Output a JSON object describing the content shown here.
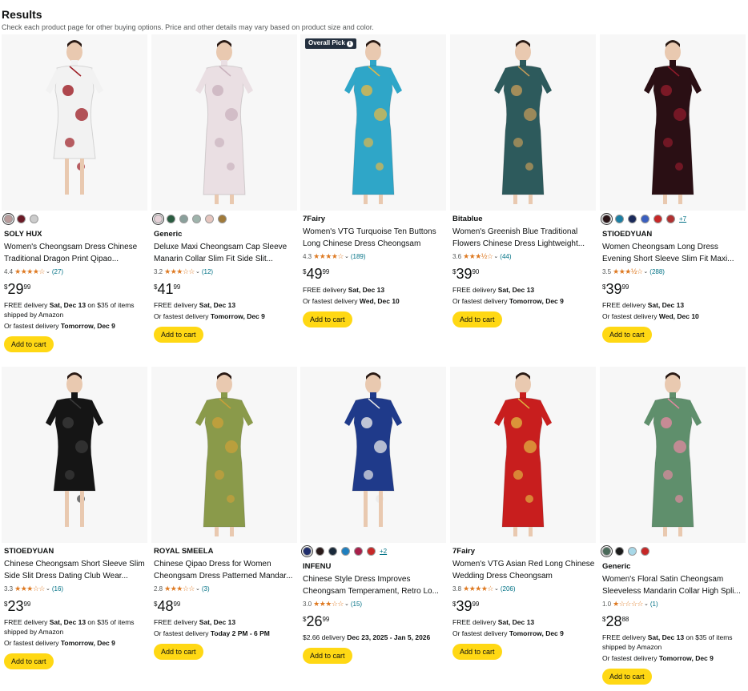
{
  "header": {
    "title": "Results",
    "subtitle": "Check each product page for other buying options. Price and other details may vary based on product size and color."
  },
  "products": [
    {
      "brand": "SOLY HUX",
      "title": "Women's Cheongsam Dress Chinese Traditional Dragon Print Qipao...",
      "rating": "4.4",
      "stars": "★★★★☆",
      "count": "(27)",
      "price_symbol": "$",
      "price_whole": "29",
      "price_cents": "99",
      "delivery_1_pre": "FREE delivery ",
      "delivery_1_bold": "Sat, Dec 13",
      "delivery_1_post": " on $35 of items shipped by Amazon",
      "delivery_2_pre": "Or fastest delivery ",
      "delivery_2_bold": "Tomorrow, Dec 9",
      "cart_label": "Add to cart",
      "badge": "",
      "swatches": [
        "#b99b9b",
        "#6b1a26",
        "#cccccc"
      ],
      "more": "",
      "dress_color": "#f2f2f2",
      "accent_color": "#9c1c23"
    },
    {
      "brand": "Generic",
      "title": "Deluxe Maxi Cheongsam Cap Sleeve Manarin Collar Slim Fit Side Slit...",
      "rating": "3.2",
      "stars": "★★★☆☆",
      "count": "(12)",
      "price_symbol": "$",
      "price_whole": "41",
      "price_cents": "99",
      "delivery_1_pre": "FREE delivery ",
      "delivery_1_bold": "Sat, Dec 13",
      "delivery_1_post": "",
      "delivery_2_pre": "Or fastest delivery ",
      "delivery_2_bold": "Tomorrow, Dec 9",
      "cart_label": "Add to cart",
      "badge": "",
      "swatches": [
        "#e6d2d8",
        "#2a5c40",
        "#8aa09b",
        "#9fb4ac",
        "#e6c6bf",
        "#a07a3a"
      ],
      "more": "",
      "dress_color": "#eadfe3",
      "accent_color": "#c9b2bd"
    },
    {
      "brand": "7Fairy",
      "title": "Women's VTG Turquoise Ten Buttons Long Chinese Dress Cheongsam",
      "rating": "4.3",
      "stars": "★★★★☆",
      "count": "(189)",
      "price_symbol": "$",
      "price_whole": "49",
      "price_cents": "99",
      "delivery_1_pre": "FREE delivery ",
      "delivery_1_bold": "Sat, Dec 13",
      "delivery_1_post": "",
      "delivery_2_pre": "Or fastest delivery ",
      "delivery_2_bold": "Wed, Dec 10",
      "cart_label": "Add to cart",
      "badge": "Overall Pick",
      "swatches": [],
      "more": "",
      "dress_color": "#2fa6c8",
      "accent_color": "#e0b84a"
    },
    {
      "brand": "Bitablue",
      "title": "Women's Greenish Blue Traditional Flowers Chinese Dress Lightweight...",
      "rating": "3.6",
      "stars": "★★★½☆",
      "count": "(44)",
      "price_symbol": "$",
      "price_whole": "39",
      "price_cents": "90",
      "delivery_1_pre": "FREE delivery ",
      "delivery_1_bold": "Sat, Dec 13",
      "delivery_1_post": "",
      "delivery_2_pre": "Or fastest delivery ",
      "delivery_2_bold": "Tomorrow, Dec 9",
      "cart_label": "Add to cart",
      "badge": "",
      "swatches": [],
      "more": "",
      "dress_color": "#2d5a5c",
      "accent_color": "#c09a5a"
    },
    {
      "brand": "STIOEDYUAN",
      "title": "Women Cheongsam Long Dress Evening Short Sleeve Slim Fit Maxi...",
      "rating": "3.5",
      "stars": "★★★½☆",
      "count": "(288)",
      "price_symbol": "$",
      "price_whole": "39",
      "price_cents": "99",
      "delivery_1_pre": "FREE delivery ",
      "delivery_1_bold": "Sat, Dec 13",
      "delivery_1_post": "",
      "delivery_2_pre": "Or fastest delivery ",
      "delivery_2_bold": "Wed, Dec 10",
      "cart_label": "Add to cart",
      "badge": "",
      "swatches": [
        "#2a1518",
        "#1c7fa3",
        "#1a2a5a",
        "#3b5fbf",
        "#c62828",
        "#b03030"
      ],
      "more": "+7",
      "dress_color": "#2a0f14",
      "accent_color": "#8e1b2b"
    },
    {
      "brand": "STIOEDYUAN",
      "title": "Chinese Cheongsam Short Sleeve Slim Side Slit Dress Dating Club Wear...",
      "rating": "3.3",
      "stars": "★★★☆☆",
      "count": "(16)",
      "price_symbol": "$",
      "price_whole": "23",
      "price_cents": "99",
      "delivery_1_pre": "FREE delivery ",
      "delivery_1_bold": "Sat, Dec 13",
      "delivery_1_post": " on $35 of items shipped by Amazon",
      "delivery_2_pre": "Or fastest delivery ",
      "delivery_2_bold": "Tomorrow, Dec 9",
      "cart_label": "Add to cart",
      "badge": "",
      "swatches": [],
      "more": "",
      "dress_color": "#151515",
      "accent_color": "#3a3a3a"
    },
    {
      "brand": "ROYAL SMEELA",
      "title": "Chinese Qipao Dress for Women Cheongsam Dress Patterned Mandar...",
      "rating": "2.8",
      "stars": "★★★☆☆",
      "count": "(3)",
      "price_symbol": "$",
      "price_whole": "48",
      "price_cents": "99",
      "delivery_1_pre": "FREE delivery ",
      "delivery_1_bold": "Sat, Dec 13",
      "delivery_1_post": "",
      "delivery_2_pre": "Or fastest delivery ",
      "delivery_2_bold": "Today 2 PM - 6 PM",
      "cart_label": "Add to cart",
      "badge": "",
      "swatches": [],
      "more": "",
      "dress_color": "#8a9a4a",
      "accent_color": "#c9a03a"
    },
    {
      "brand": "INFENU",
      "title": "Chinese Style Dress Improves Cheongsam Temperament, Retro Lo...",
      "rating": "3.0",
      "stars": "★★★☆☆",
      "count": "(15)",
      "price_symbol": "$",
      "price_whole": "26",
      "price_cents": "99",
      "delivery_1_pre": "$2.66 delivery ",
      "delivery_1_bold": "Dec 23, 2025 - Jan 5, 2026",
      "delivery_1_post": "",
      "delivery_2_pre": "",
      "delivery_2_bold": "",
      "cart_label": "Add to cart",
      "badge": "",
      "swatches": [
        "#1f2d6b",
        "#2a1a1a",
        "#1a2a3a",
        "#1f7fbf",
        "#a8204a",
        "#c62828"
      ],
      "more": "+2",
      "dress_color": "#1f3a8a",
      "accent_color": "#e8e8e8"
    },
    {
      "brand": "7Fairy",
      "title": "Women's VTG Asian Red Long Chinese Wedding Dress Cheongsam",
      "rating": "3.8",
      "stars": "★★★★☆",
      "count": "(206)",
      "price_symbol": "$",
      "price_whole": "39",
      "price_cents": "99",
      "delivery_1_pre": "FREE delivery ",
      "delivery_1_bold": "Sat, Dec 13",
      "delivery_1_post": "",
      "delivery_2_pre": "Or fastest delivery ",
      "delivery_2_bold": "Tomorrow, Dec 9",
      "cart_label": "Add to cart",
      "badge": "",
      "swatches": [],
      "more": "",
      "dress_color": "#c81e1e",
      "accent_color": "#e0b040"
    },
    {
      "brand": "Generic",
      "title": "Women's Floral Satin Cheongsam Sleeveless Mandarin Collar High Spli...",
      "rating": "1.0",
      "stars": "★☆☆☆☆",
      "count": "(1)",
      "price_symbol": "$",
      "price_whole": "28",
      "price_cents": "88",
      "delivery_1_pre": "FREE delivery ",
      "delivery_1_bold": "Sat, Dec 13",
      "delivery_1_post": " on $35 of items shipped by Amazon",
      "delivery_2_pre": "Or fastest delivery ",
      "delivery_2_bold": "Tomorrow, Dec 9",
      "cart_label": "Add to cart",
      "badge": "",
      "swatches": [
        "#4a6a5a",
        "#1a1a1a",
        "#a8d8e8",
        "#c62828"
      ],
      "more": "",
      "dress_color": "#5f8f6c",
      "accent_color": "#e08aa0"
    }
  ]
}
